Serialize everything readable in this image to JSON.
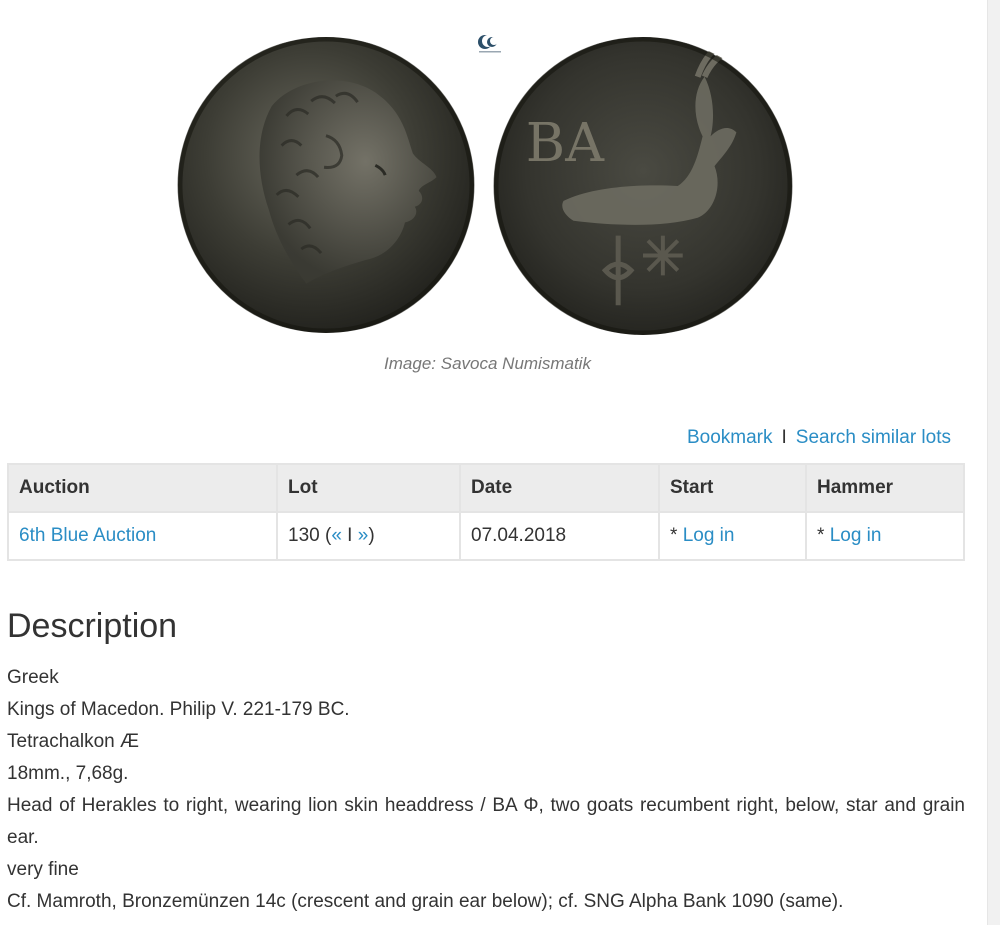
{
  "image": {
    "caption": "Image: Savoca Numismatik",
    "obverse_legend": "",
    "reverse_legend": "ΒΑ"
  },
  "actions": {
    "bookmark": "Bookmark",
    "separator": "I",
    "search_similar": "Search similar lots"
  },
  "table": {
    "headers": {
      "auction": "Auction",
      "lot": "Lot",
      "date": "Date",
      "start": "Start",
      "hammer": "Hammer"
    },
    "row": {
      "auction": "6th Blue Auction",
      "lot_number": "130 (",
      "lot_prev": "«",
      "lot_sep": " I ",
      "lot_next": "»",
      "lot_close": ")",
      "date": "07.04.2018",
      "start_prefix": "* ",
      "start_link": "Log in",
      "hammer_prefix": "* ",
      "hammer_link": "Log in"
    }
  },
  "description": {
    "heading": "Description",
    "lines": [
      "Greek",
      "Kings of Macedon. Philip V. 221-179 BC.",
      "Tetrachalkon Æ",
      "18mm., 7,68g.",
      "Head of Herakles to right, wearing lion skin headdress / BA Φ, two goats recumbent right, below, star and grain ear.",
      "very fine",
      "Cf. Mamroth, Bronzemünzen 14c (crescent and grain ear below); cf. SNG Alpha Bank 1090 (same)."
    ]
  },
  "colors": {
    "link": "#2a8dc5",
    "text": "#333333",
    "caption": "#777777",
    "table_header_bg": "#ececec",
    "table_border": "#e4e4e4"
  }
}
